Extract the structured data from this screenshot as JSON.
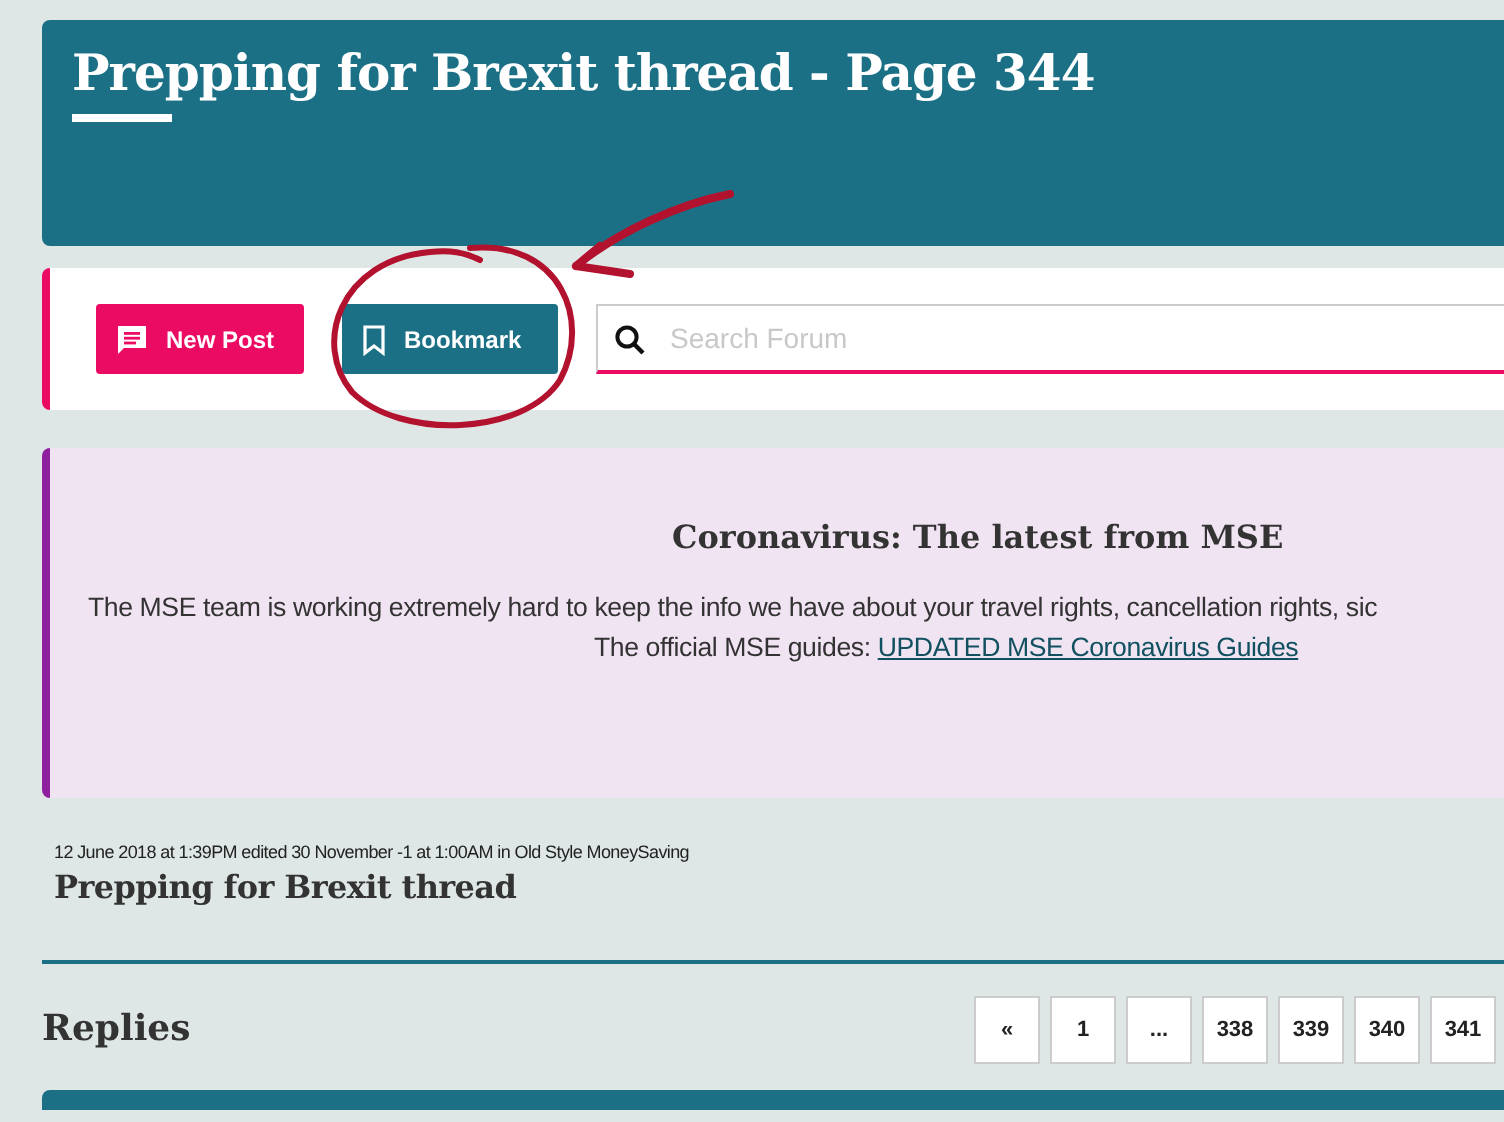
{
  "header": {
    "title": "Prepping for Brexit thread - Page 344"
  },
  "toolbar": {
    "buttons": [
      {
        "kind": "new",
        "label": "New Post"
      },
      {
        "kind": "bookmark",
        "label": "Bookmark"
      }
    ],
    "search": {
      "placeholder": "Search Forum"
    }
  },
  "notice": {
    "heading": "Coronavirus: The latest from MSE",
    "text": "The MSE team is working extremely hard to keep the info we have about your travel rights, cancellation rights, sic",
    "guides_label": "The official MSE guides: ",
    "guides_link": "UPDATED MSE Coronavirus Guides"
  },
  "thread": {
    "meta": "12 June 2018 at 1:39PM edited 30 November -1 at 1:00AM in Old Style MoneySaving",
    "title": "Prepping for Brexit thread"
  },
  "replies": {
    "heading": "Replies",
    "pages": [
      "«",
      "1",
      "...",
      "338",
      "339",
      "340",
      "341"
    ]
  }
}
